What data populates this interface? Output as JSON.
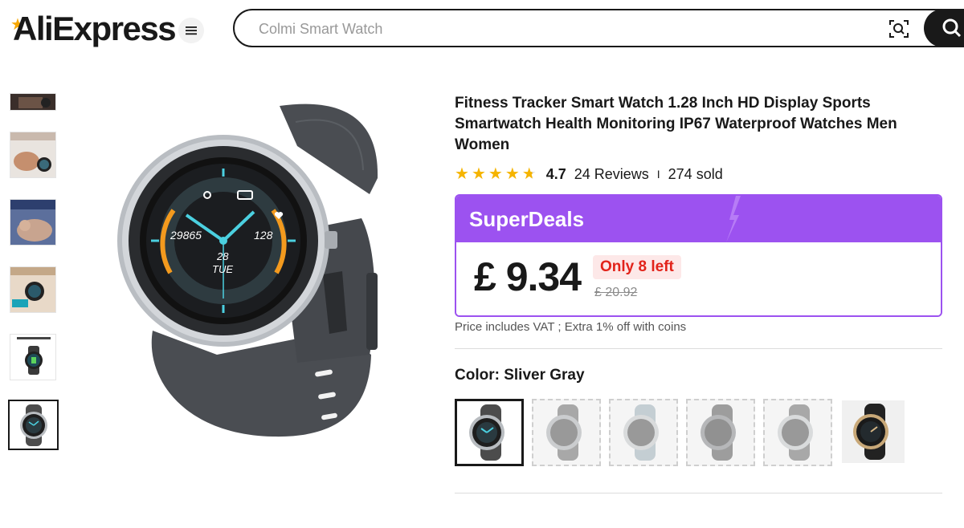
{
  "header": {
    "logo": "AliExpress",
    "search": {
      "value": "",
      "placeholder": "Colmi Smart Watch"
    }
  },
  "icons": {
    "menu": "hamburger-menu-icon",
    "camera": "camera-search-icon",
    "search": "magnifier-icon",
    "star": "star-icon",
    "bolt": "lightning-bolt-icon"
  },
  "thumbnails": [
    {
      "label": ""
    },
    {
      "label": ""
    },
    {
      "label": "SLEEP MONITORING"
    },
    {
      "label": ""
    },
    {
      "label": "LONG STANDBY"
    },
    {
      "label": ""
    }
  ],
  "product": {
    "title": "Fitness Tracker Smart Watch 1.28 Inch HD Display Sports Smartwatch Health Monitoring IP67 Waterproof Watches Men Women",
    "rating": "4.7",
    "rating_value": 4.7,
    "reviews": "24 Reviews",
    "separator": "I",
    "sold": "274 sold",
    "watch_face": {
      "steps": "29865",
      "heart": "128",
      "day": "28",
      "weekday": "TUE"
    }
  },
  "deal": {
    "label": "SuperDeals",
    "price": "£ 9.34",
    "stock": "Only 8 left",
    "old_price": "£ 20.92"
  },
  "vat_note": "Price includes VAT ; Extra 1% off with coins",
  "color": {
    "label": "Color: Sliver Gray",
    "options": [
      {
        "name": "sliver-gray",
        "selected": true
      },
      {
        "name": "gray-1",
        "selected": false
      },
      {
        "name": "gray-2",
        "selected": false
      },
      {
        "name": "gray-3",
        "selected": false
      },
      {
        "name": "gray-4",
        "selected": false
      },
      {
        "name": "gold-black",
        "selected": false
      }
    ]
  },
  "colors": {
    "accent_purple": "#9c52f0",
    "stock_red": "#e2231a",
    "star_yellow": "#f5b400",
    "logo_orange": "#f7a700"
  }
}
